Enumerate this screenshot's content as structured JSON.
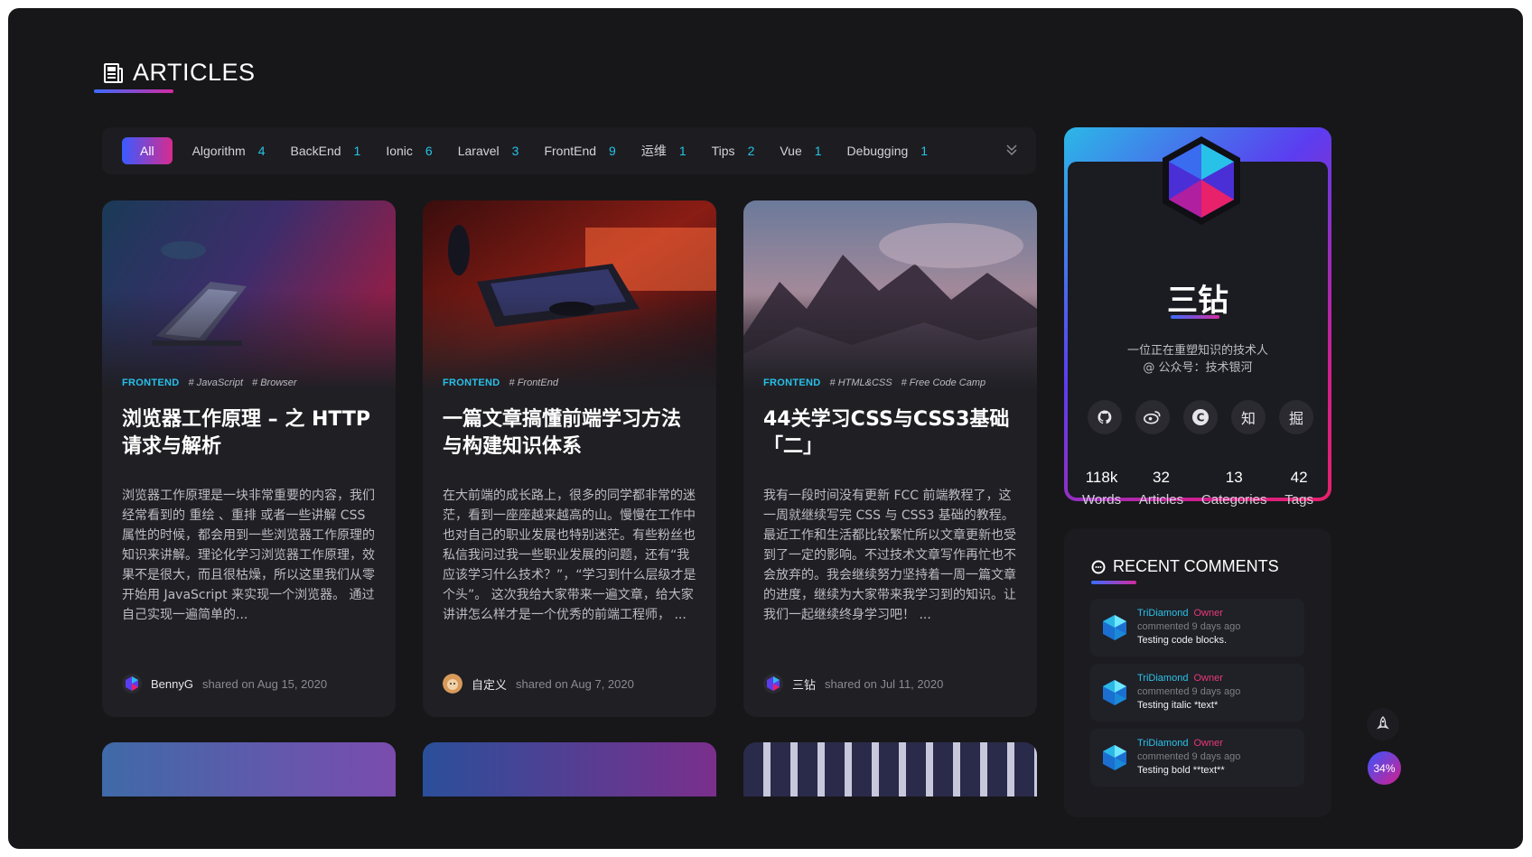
{
  "header": {
    "title": "ARTICLES",
    "icon": "newspaper-icon"
  },
  "categories": [
    {
      "label": "All",
      "count": "",
      "active": true
    },
    {
      "label": "Algorithm",
      "count": "4"
    },
    {
      "label": "BackEnd",
      "count": "1"
    },
    {
      "label": "Ionic",
      "count": "6"
    },
    {
      "label": "Laravel",
      "count": "3"
    },
    {
      "label": "FrontEnd",
      "count": "9"
    },
    {
      "label": "运维",
      "count": "1"
    },
    {
      "label": "Tips",
      "count": "2"
    },
    {
      "label": "Vue",
      "count": "1"
    },
    {
      "label": "Debugging",
      "count": "1"
    }
  ],
  "articles": [
    {
      "category": "FRONTEND",
      "tags": [
        "# JavaScript",
        "# Browser"
      ],
      "title": "浏览器工作原理 – 之 HTTP 请求与解析",
      "excerpt": "浏览器工作原理是一块非常重要的内容，我们经常看到的 重绘 、重排 或者一些讲解 CSS 属性的时候，都会用到一些浏览器工作原理的知识来讲解。理论化学习浏览器工作原理，效果不是很大，而且很枯燥，所以这里我们从零开始用 JavaScript 来实现一个浏览器。 通过自己实现一遍简单的...",
      "author": "BennyG",
      "date": "shared on Aug 15, 2020"
    },
    {
      "category": "FRONTEND",
      "tags": [
        "# FrontEnd"
      ],
      "title": "一篇文章搞懂前端学习方法与构建知识体系",
      "excerpt": "在大前端的成长路上，很多的同学都非常的迷茫，看到一座座越来越高的山。慢慢在工作中也对自己的职业发展也特别迷茫。有些粉丝也私信我问过我一些职业发展的问题，还有“我应该学习什么技术？”，“学习到什么层级才是个头”。 这次我给大家带来一遍文章，给大家讲讲怎么样才是一个优秀的前端工程师， ...",
      "author": "自定义",
      "date": "shared on Aug 7, 2020"
    },
    {
      "category": "FRONTEND",
      "tags": [
        "# HTML&CSS",
        "# Free Code Camp"
      ],
      "title": "44关学习CSS与CSS3基础「二」",
      "excerpt": "我有一段时间没有更新 FCC 前端教程了，这一周就继续写完 CSS 与 CSS3 基础的教程。最近工作和生活都比较繁忙所以文章更新也受到了一定的影响。不过技术文章写作再忙也不会放弃的。我会继续努力坚持着一周一篇文章的进度，继续为大家带来我学习到的知识。让我们一起继续终身学习吧！ ...",
      "author": "三钻",
      "date": "shared on Jul 11, 2020"
    }
  ],
  "profile": {
    "name": "三钻",
    "bio_line1": "一位正在重塑知识的技术人",
    "bio_line2": "@ 公众号：技术银河",
    "socials": [
      {
        "icon": "github-icon",
        "glyph": ""
      },
      {
        "icon": "weibo-icon",
        "glyph": ""
      },
      {
        "icon": "csdn-icon",
        "glyph": "C"
      },
      {
        "icon": "zhihu-icon",
        "glyph": "知"
      },
      {
        "icon": "juejin-icon",
        "glyph": "掘"
      }
    ],
    "stats": [
      {
        "value": "118k",
        "label": "Words"
      },
      {
        "value": "32",
        "label": "Articles"
      },
      {
        "value": "13",
        "label": "Categories"
      },
      {
        "value": "42",
        "label": "Tags"
      }
    ]
  },
  "recent_comments": {
    "title": "RECENT COMMENTS",
    "items": [
      {
        "user": "TriDiamond",
        "role": "Owner",
        "when": "commented 9 days ago",
        "text": "Testing code blocks."
      },
      {
        "user": "TriDiamond",
        "role": "Owner",
        "when": "commented 9 days ago",
        "text": "Testing italic *text*"
      },
      {
        "user": "TriDiamond",
        "role": "Owner",
        "when": "commented 9 days ago",
        "text": "Testing bold **text**"
      }
    ]
  },
  "reading_progress": "34%",
  "colors": {
    "accent_cyan": "#26c0e8",
    "accent_pink": "#d72b8f",
    "accent_blue": "#3a5bff",
    "bg": "#17171a"
  }
}
